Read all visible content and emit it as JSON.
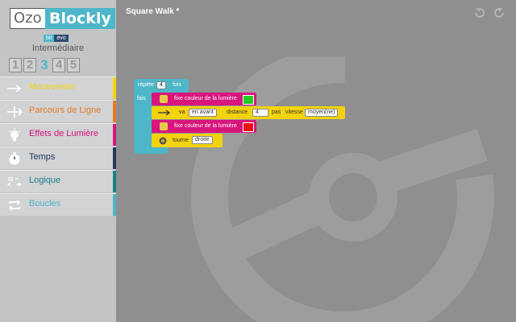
{
  "app": {
    "logo_ozo": "Ozo",
    "logo_blockly": "Blockly",
    "badge_bit": "bit",
    "badge_evo": "evo",
    "level_label": "Intermédiaire",
    "levels": [
      "1",
      "2",
      "3",
      "4",
      "5"
    ],
    "active_level": "3"
  },
  "categories": [
    {
      "label": "Mouvement",
      "color": "#f2d30d",
      "icon": "arrow-right-icon"
    },
    {
      "label": "Parcours de Ligne",
      "color": "#e37b24",
      "icon": "line-follow-icon"
    },
    {
      "label": "Effets de Lumière",
      "color": "#d8157c",
      "icon": "light-bulb-icon"
    },
    {
      "label": "Temps",
      "color": "#24365a",
      "icon": "stopwatch-icon"
    },
    {
      "label": "Logique",
      "color": "#1a7e86",
      "icon": "logic-arrows-icon"
    },
    {
      "label": "Boucles",
      "color": "#4db6c8",
      "icon": "loop-icon"
    }
  ],
  "workspace": {
    "title": "Square Walk *",
    "blocks": {
      "repeat": {
        "prefix": "répète",
        "count": "4",
        "suffix": "fois",
        "do_label": "fais"
      },
      "light1": {
        "label": "fixe couleur de la lumière",
        "color": "#22cc22"
      },
      "move": {
        "verb": "va",
        "direction": "en avant",
        "distance_label": "distance",
        "distance": "4",
        "unit": "pas",
        "speed_label": "vitesse",
        "speed": "moyen(ne)"
      },
      "light2": {
        "label": "fixe couleur de la lumière",
        "color": "#ee1111"
      },
      "turn": {
        "verb": "tourne",
        "direction": "droite"
      }
    }
  },
  "colors": {
    "accent": "#4db6c8",
    "workspace_bg": "#8f8f8f",
    "sidebar_bg": "#c3c4c6"
  }
}
